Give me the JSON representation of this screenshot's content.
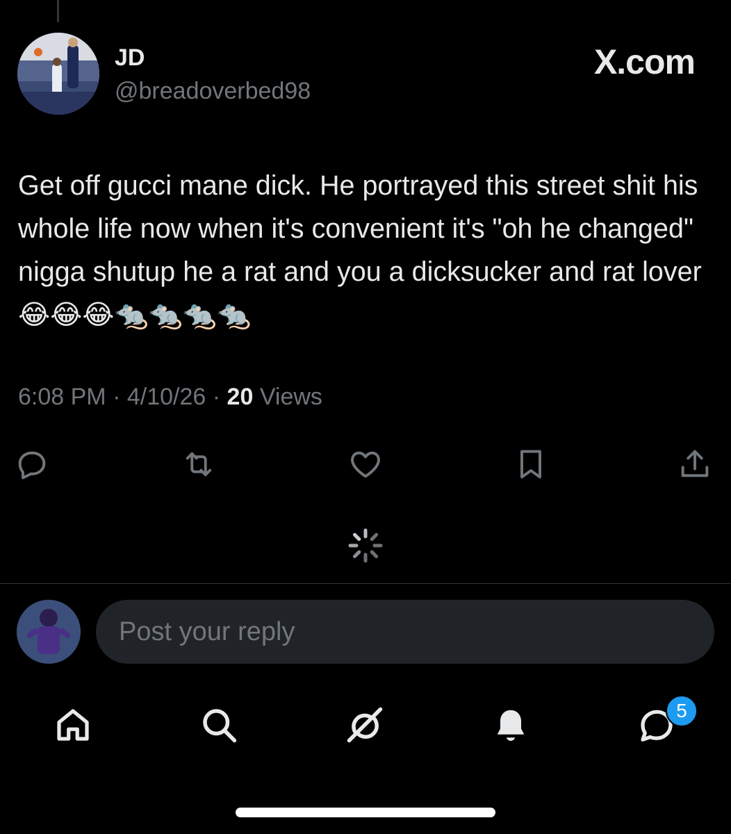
{
  "author": {
    "display_name": "JD",
    "handle": "@breadoverbed98",
    "avatar_icon": "basketball-player-avatar"
  },
  "brand": {
    "label": "X.com"
  },
  "tweet": {
    "text": "Get off gucci mane dick. He portrayed this street shit his whole life now when it's convenient it's \"oh he changed\" nigga shutup he a rat and you a dicksucker and rat lover 😂😂😂🐀🐀🐀🐀",
    "time": "6:08 PM",
    "date": "4/10/26",
    "views_count": "20",
    "views_label": "Views"
  },
  "actions": [
    {
      "name": "reply-icon"
    },
    {
      "name": "retweet-icon"
    },
    {
      "name": "like-icon"
    },
    {
      "name": "bookmark-icon"
    },
    {
      "name": "share-icon"
    }
  ],
  "reply": {
    "placeholder": "Post your reply",
    "avatar_icon": "football-player-avatar"
  },
  "nav": {
    "items": [
      {
        "name": "home-icon"
      },
      {
        "name": "search-icon"
      },
      {
        "name": "grok-icon"
      },
      {
        "name": "notifications-icon"
      },
      {
        "name": "messages-icon"
      }
    ],
    "messages_badge": "5"
  },
  "colors": {
    "background": "#000000",
    "text": "#e7e9ea",
    "muted": "#71767b",
    "accent": "#1d9bf0",
    "input_bg": "#202327"
  }
}
